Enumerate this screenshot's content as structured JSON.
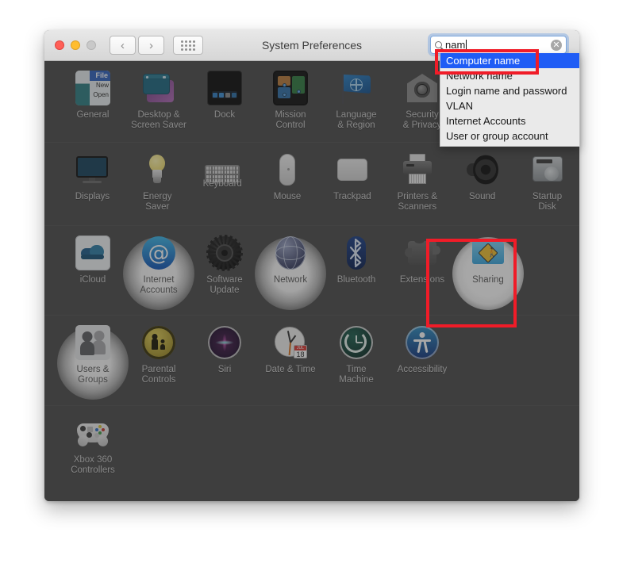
{
  "window": {
    "title": "System Preferences",
    "traffic_lights": [
      "close",
      "minimize",
      "maximize"
    ],
    "toolbar": {
      "back_label": "‹",
      "forward_label": "›",
      "grid_label": "show-all"
    }
  },
  "search": {
    "value": "nam",
    "placeholder": "Search",
    "icon": "search-icon",
    "clear_label": "✕"
  },
  "suggestions": {
    "selected_index": 0,
    "items": [
      "Computer name",
      "Network name",
      "Login name and password",
      "VLAN",
      "Internet Accounts",
      "User or group account"
    ]
  },
  "annotations": {
    "highlight_color": "#f01c28",
    "boxes": [
      "Computer name",
      "Sharing"
    ]
  },
  "rows": [
    {
      "items": [
        {
          "label": "General",
          "icon": "general-icon",
          "highlight": "none"
        },
        {
          "label": "Desktop &\nScreen Saver",
          "icon": "desktop-screensaver-icon",
          "highlight": "none"
        },
        {
          "label": "Dock",
          "icon": "dock-icon",
          "highlight": "none"
        },
        {
          "label": "Mission\nControl",
          "icon": "mission-control-icon",
          "highlight": "none"
        },
        {
          "label": "Language\n& Region",
          "icon": "language-region-icon",
          "highlight": "none"
        },
        {
          "label": "Security\n& Privacy",
          "icon": "security-privacy-icon",
          "highlight": "none"
        }
      ]
    },
    {
      "items": [
        {
          "label": "Displays",
          "icon": "displays-icon",
          "highlight": "none"
        },
        {
          "label": "Energy\nSaver",
          "icon": "energy-saver-icon",
          "highlight": "none"
        },
        {
          "label": "Keyboard",
          "icon": "keyboard-icon",
          "highlight": "none"
        },
        {
          "label": "Mouse",
          "icon": "mouse-icon",
          "highlight": "none"
        },
        {
          "label": "Trackpad",
          "icon": "trackpad-icon",
          "highlight": "none"
        },
        {
          "label": "Printers &\nScanners",
          "icon": "printers-scanners-icon",
          "highlight": "none"
        },
        {
          "label": "Sound",
          "icon": "sound-icon",
          "highlight": "none"
        },
        {
          "label": "Startup\nDisk",
          "icon": "startup-disk-icon",
          "highlight": "none"
        }
      ]
    },
    {
      "items": [
        {
          "label": "iCloud",
          "icon": "icloud-icon",
          "highlight": "none"
        },
        {
          "label": "Internet\nAccounts",
          "icon": "internet-accounts-icon",
          "highlight": "glow"
        },
        {
          "label": "Software\nUpdate",
          "icon": "software-update-icon",
          "highlight": "none"
        },
        {
          "label": "Network",
          "icon": "network-icon",
          "highlight": "glow"
        },
        {
          "label": "Bluetooth",
          "icon": "bluetooth-icon",
          "highlight": "none"
        },
        {
          "label": "Extensions",
          "icon": "extensions-icon",
          "highlight": "none"
        },
        {
          "label": "Sharing",
          "icon": "sharing-icon",
          "highlight": "strong"
        }
      ]
    },
    {
      "items": [
        {
          "label": "Users &\nGroups",
          "icon": "users-groups-icon",
          "highlight": "glow"
        },
        {
          "label": "Parental\nControls",
          "icon": "parental-controls-icon",
          "highlight": "none"
        },
        {
          "label": "Siri",
          "icon": "siri-icon",
          "highlight": "none"
        },
        {
          "label": "Date & Time",
          "icon": "date-time-icon",
          "highlight": "none"
        },
        {
          "label": "Time\nMachine",
          "icon": "time-machine-icon",
          "highlight": "none"
        },
        {
          "label": "Accessibility",
          "icon": "accessibility-icon",
          "highlight": "none"
        }
      ]
    },
    {
      "items": [
        {
          "label": "Xbox 360\nControllers",
          "icon": "xbox-360-controllers-icon",
          "highlight": "none"
        }
      ]
    }
  ],
  "date_time_icon": {
    "month": "JUL",
    "day": "18"
  }
}
